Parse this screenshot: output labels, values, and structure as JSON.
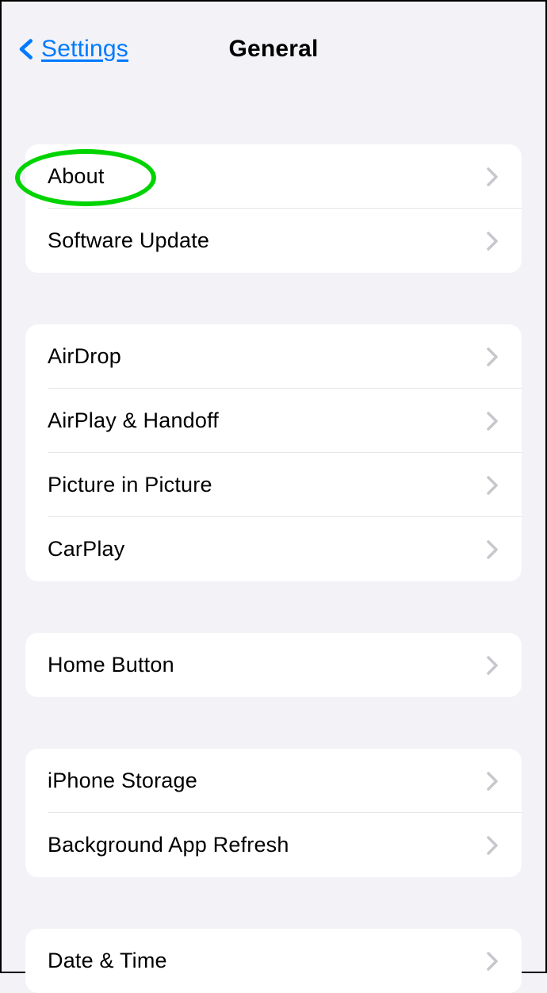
{
  "header": {
    "back_label": "Settings",
    "title": "General"
  },
  "groups": [
    {
      "items": [
        {
          "label": "About",
          "name": "row-about"
        },
        {
          "label": "Software Update",
          "name": "row-software-update"
        }
      ]
    },
    {
      "items": [
        {
          "label": "AirDrop",
          "name": "row-airdrop"
        },
        {
          "label": "AirPlay & Handoff",
          "name": "row-airplay-handoff"
        },
        {
          "label": "Picture in Picture",
          "name": "row-picture-in-picture"
        },
        {
          "label": "CarPlay",
          "name": "row-carplay"
        }
      ]
    },
    {
      "items": [
        {
          "label": "Home Button",
          "name": "row-home-button"
        }
      ]
    },
    {
      "items": [
        {
          "label": "iPhone Storage",
          "name": "row-iphone-storage"
        },
        {
          "label": "Background App Refresh",
          "name": "row-background-app-refresh"
        }
      ]
    },
    {
      "items": [
        {
          "label": "Date & Time",
          "name": "row-date-time"
        }
      ]
    }
  ]
}
